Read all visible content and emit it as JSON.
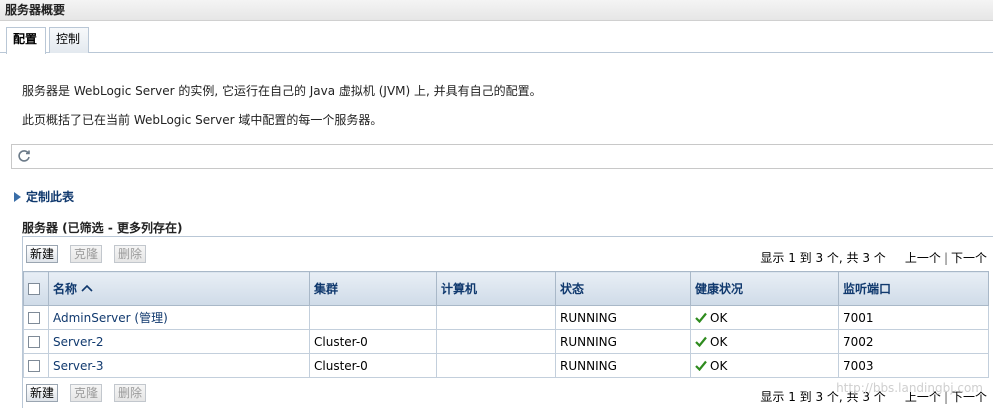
{
  "page": {
    "title": "服务器概要"
  },
  "tabs": [
    {
      "label": "配置"
    },
    {
      "label": "控制"
    }
  ],
  "description": [
    "服务器是 WebLogic Server 的实例, 它运行在自己的 Java 虚拟机 (JVM) 上, 并具有自己的配置。",
    "此页概括了已在当前 WebLogic Server 域中配置的每一个服务器。"
  ],
  "customize": {
    "label": "定制此表"
  },
  "table": {
    "title": "服务器 (已筛选 - 更多列存在)",
    "buttons": {
      "new": "新建",
      "clone": "克隆",
      "delete": "删除"
    },
    "pager": {
      "summary": "显示 1 到 3 个, 共 3 个",
      "prev": "上一个",
      "next": "下一个"
    },
    "columns": [
      "名称",
      "集群",
      "计算机",
      "状态",
      "健康状况",
      "监听端口"
    ],
    "rows": [
      {
        "name": "AdminServer (管理)",
        "cluster": "",
        "machine": "",
        "state": "RUNNING",
        "health": "OK",
        "port": "7001"
      },
      {
        "name": "Server-2",
        "cluster": "Cluster-0",
        "machine": "",
        "state": "RUNNING",
        "health": "OK",
        "port": "7002"
      },
      {
        "name": "Server-3",
        "cluster": "Cluster-0",
        "machine": "",
        "state": "RUNNING",
        "health": "OK",
        "port": "7003"
      }
    ]
  },
  "icons": {
    "refresh": "refresh-icon",
    "sort": "sort-ascending-icon",
    "health": "checkmark-icon",
    "expand": "expand-triangle-icon"
  },
  "colors": {
    "link": "#10396e",
    "header_bg": "#cfdbe8",
    "ok_check": "#2e8b1e"
  },
  "watermark": "http://bbs.landingbj.com"
}
